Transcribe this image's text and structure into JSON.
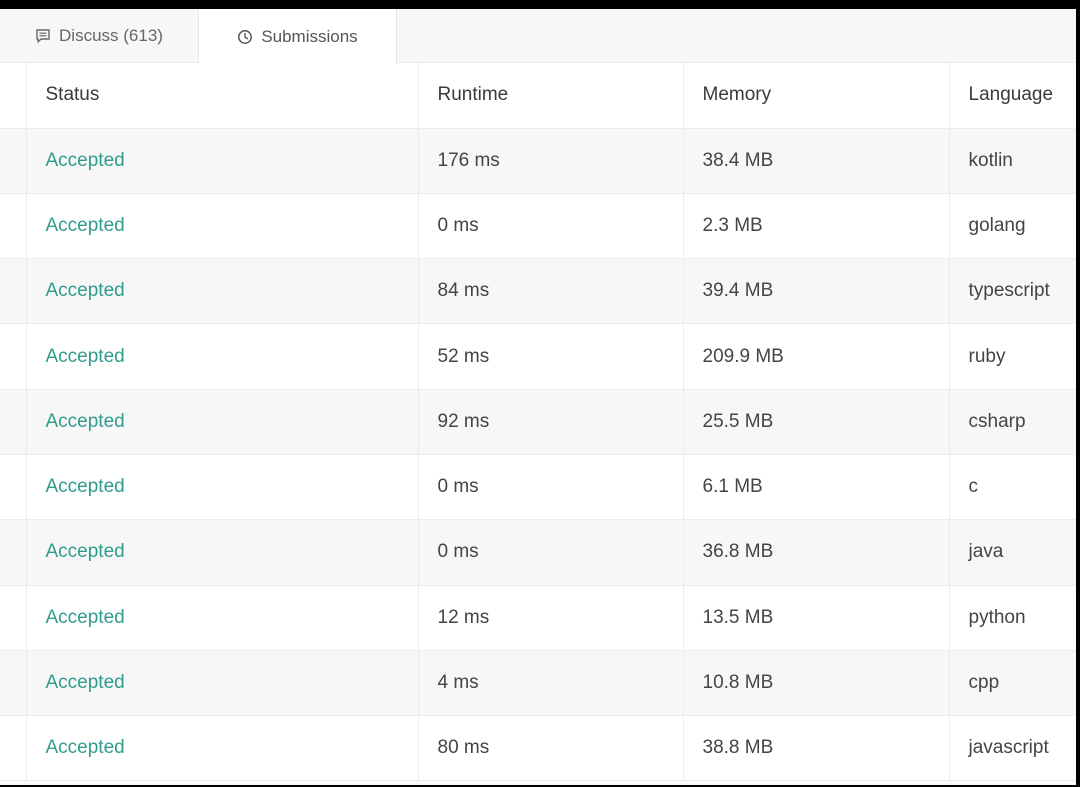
{
  "tabs": {
    "discuss": {
      "label": "Discuss (613)",
      "icon": "comment-icon"
    },
    "submissions": {
      "label": "Submissions",
      "icon": "clock-icon",
      "active": true
    }
  },
  "table": {
    "headers": {
      "status": "Status",
      "runtime": "Runtime",
      "memory": "Memory",
      "language": "Language"
    },
    "rows": [
      {
        "status": "Accepted",
        "runtime": "176 ms",
        "memory": "38.4 MB",
        "language": "kotlin"
      },
      {
        "status": "Accepted",
        "runtime": "0 ms",
        "memory": "2.3 MB",
        "language": "golang"
      },
      {
        "status": "Accepted",
        "runtime": "84 ms",
        "memory": "39.4 MB",
        "language": "typescript"
      },
      {
        "status": "Accepted",
        "runtime": "52 ms",
        "memory": "209.9 MB",
        "language": "ruby"
      },
      {
        "status": "Accepted",
        "runtime": "92 ms",
        "memory": "25.5 MB",
        "language": "csharp"
      },
      {
        "status": "Accepted",
        "runtime": "0 ms",
        "memory": "6.1 MB",
        "language": "c"
      },
      {
        "status": "Accepted",
        "runtime": "0 ms",
        "memory": "36.8 MB",
        "language": "java"
      },
      {
        "status": "Accepted",
        "runtime": "12 ms",
        "memory": "13.5 MB",
        "language": "python"
      },
      {
        "status": "Accepted",
        "runtime": "4 ms",
        "memory": "10.8 MB",
        "language": "cpp"
      },
      {
        "status": "Accepted",
        "runtime": "80 ms",
        "memory": "38.8 MB",
        "language": "javascript"
      }
    ]
  },
  "colors": {
    "accepted": "#2f9c8c",
    "row_alt": "#f7f7f7"
  }
}
